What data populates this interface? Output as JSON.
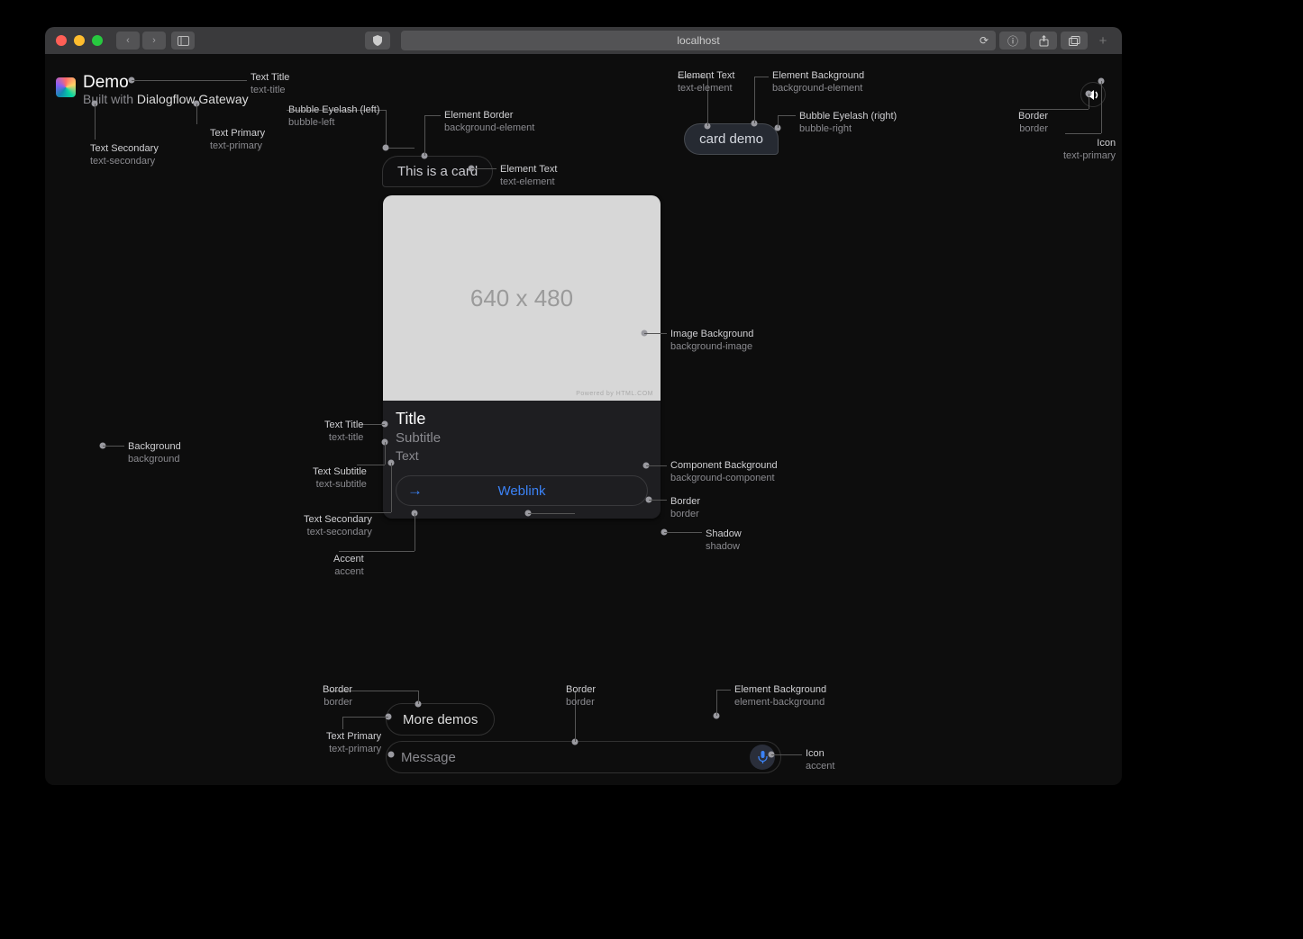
{
  "browser": {
    "url": "localhost",
    "traffic_colors": {
      "close": "#ff5f56",
      "min": "#ffbd2e",
      "max": "#27c93f"
    }
  },
  "header": {
    "title": "Demo",
    "subtitle_prefix": "Built with ",
    "subtitle_link": "Dialogflow Gateway"
  },
  "bubbles": {
    "user": "card demo",
    "bot": "This is a card"
  },
  "card": {
    "image_label": "640 x 480",
    "image_footer": "Powered by HTML.COM",
    "title": "Title",
    "subtitle": "Subtitle",
    "text": "Text",
    "button_label": "Weblink"
  },
  "footer": {
    "suggestion": "More demos",
    "input_placeholder": "Message"
  },
  "annotations": {
    "text_title": {
      "l1": "Text Title",
      "l2": "text-title"
    },
    "text_secondary": {
      "l1": "Text Secondary",
      "l2": "text-secondary"
    },
    "text_primary": {
      "l1": "Text Primary",
      "l2": "text-primary"
    },
    "bubble_left": {
      "l1": "Bubble Eyelash (left)",
      "l2": "bubble-left"
    },
    "element_border": {
      "l1": "Element Border",
      "l2": "background-element"
    },
    "element_text": {
      "l1": "Element Text",
      "l2": "text-element"
    },
    "element_text2": {
      "l1": "Element Text",
      "l2": "text-element"
    },
    "bg_element": {
      "l1": "Element Background",
      "l2": "background-element"
    },
    "bubble_right": {
      "l1": "Bubble Eyelash (right)",
      "l2": "bubble-right"
    },
    "border_top": {
      "l1": "Border",
      "l2": "border"
    },
    "icon_top": {
      "l1": "Icon",
      "l2": "text-primary"
    },
    "img_bg": {
      "l1": "Image Background",
      "l2": "background-image"
    },
    "card_title": {
      "l1": "Text Title",
      "l2": "text-title"
    },
    "card_subtitle": {
      "l1": "Text Subtitle",
      "l2": "text-subtitle"
    },
    "card_text": {
      "l1": "Text Secondary",
      "l2": "text-secondary"
    },
    "accent": {
      "l1": "Accent",
      "l2": "accent"
    },
    "background": {
      "l1": "Background",
      "l2": "background"
    },
    "comp_bg": {
      "l1": "Component Background",
      "l2": "background-component"
    },
    "border_card": {
      "l1": "Border",
      "l2": "border"
    },
    "shadow": {
      "l1": "Shadow",
      "l2": "shadow"
    },
    "border_pill1": {
      "l1": "Border",
      "l2": "border"
    },
    "border_pill2": {
      "l1": "Border",
      "l2": "border"
    },
    "footer_text_primary": {
      "l1": "Text Primary",
      "l2": "text-primary"
    },
    "elem_bg_mic": {
      "l1": "Element Background",
      "l2": "element-background"
    },
    "icon_mic": {
      "l1": "Icon",
      "l2": "accent"
    }
  }
}
